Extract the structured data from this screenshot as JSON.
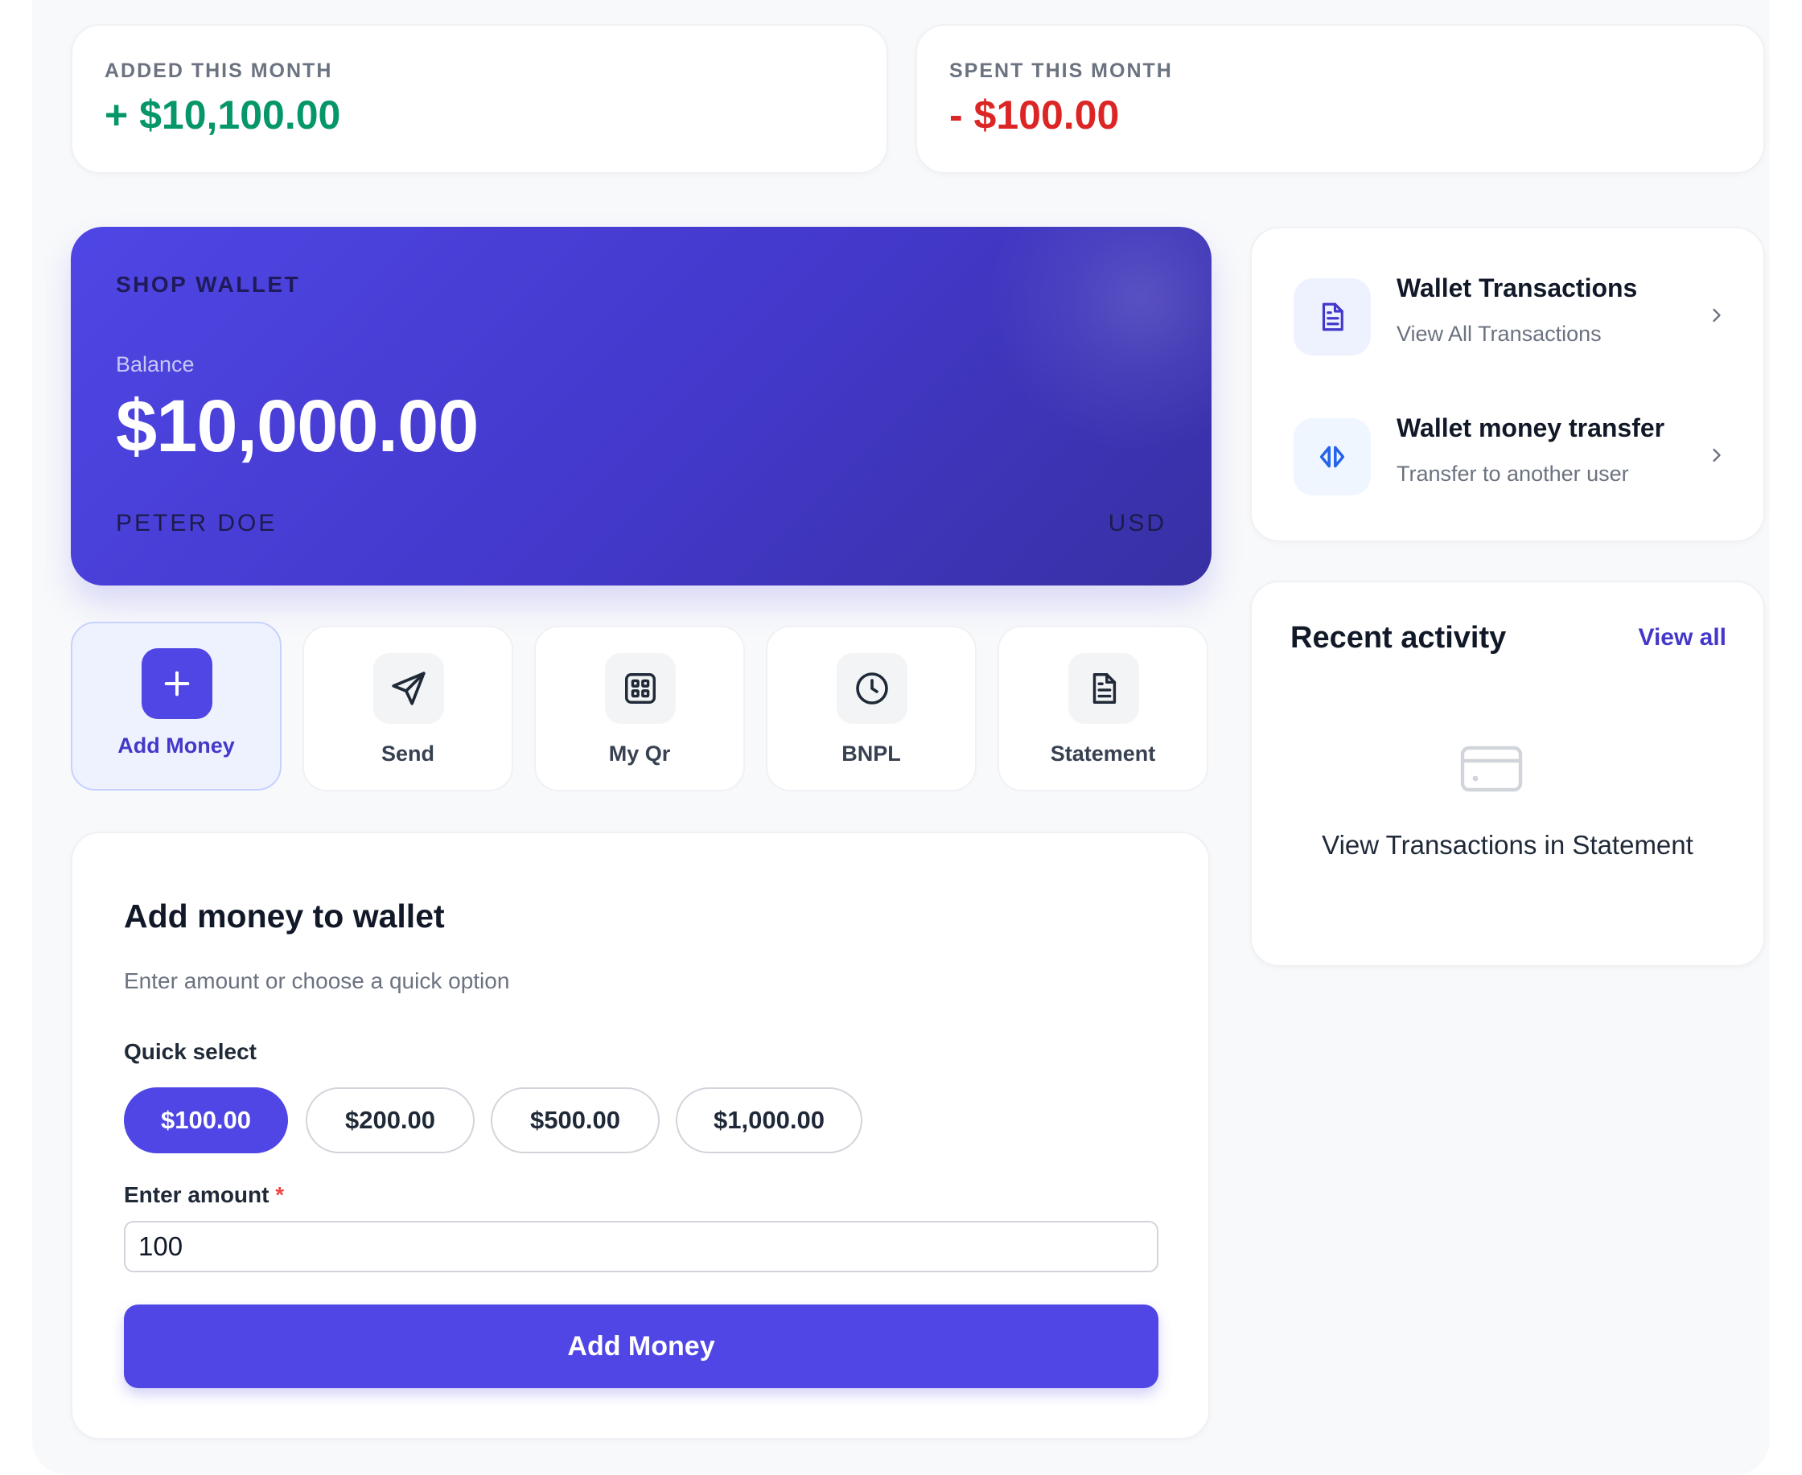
{
  "stats": {
    "added": {
      "label": "ADDED THIS MONTH",
      "value": "+ $10,100.00",
      "color": "#059669"
    },
    "spent": {
      "label": "SPENT THIS MONTH",
      "value": "- $100.00",
      "color": "#dc2626"
    }
  },
  "wallet": {
    "name": "SHOP WALLET",
    "balance_label": "Balance",
    "balance": "$10,000.00",
    "holder": "PETER DOE",
    "currency": "USD",
    "accent": "#4f46e5"
  },
  "actions": [
    {
      "label": "Add Money",
      "icon": "plus-icon",
      "active": true
    },
    {
      "label": "Send",
      "icon": "paper-plane-icon",
      "active": false
    },
    {
      "label": "My Qr",
      "icon": "qr-grid-icon",
      "active": false
    },
    {
      "label": "BNPL",
      "icon": "clock-icon",
      "active": false
    },
    {
      "label": "Statement",
      "icon": "document-icon",
      "active": false
    }
  ],
  "add_money_form": {
    "title": "Add money to wallet",
    "subtitle": "Enter amount or choose a quick option",
    "quick_select_label": "Quick select",
    "quick_options": [
      "$100.00",
      "$200.00",
      "$500.00",
      "$1,000.00"
    ],
    "selected_option": "$100.00",
    "amount_label": "Enter amount",
    "required_marker": "*",
    "amount_value": "100",
    "submit_label": "Add Money"
  },
  "quick_links": [
    {
      "title": "Wallet Transactions",
      "subtitle": "View All Transactions",
      "icon": "document-icon"
    },
    {
      "title": "Wallet money transfer",
      "subtitle": "Transfer to another user",
      "icon": "transfer-arrows-icon"
    }
  ],
  "recent_activity": {
    "title": "Recent activity",
    "view_all": "View all",
    "empty_icon": "card-icon",
    "empty_text": "View Transactions in Statement"
  }
}
